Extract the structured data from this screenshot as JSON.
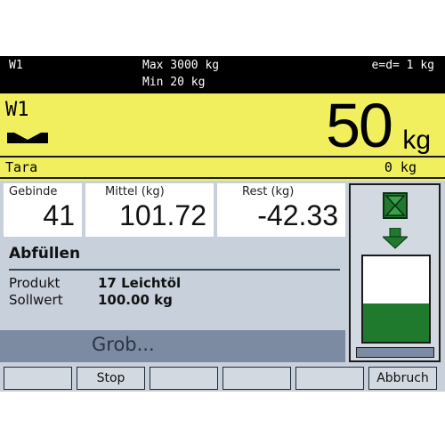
{
  "status_bar": {
    "scale_name": "W1",
    "max_capacity": "Max 3000 kg",
    "min_capacity": "Min 20 kg",
    "division": "e=d= 1 kg"
  },
  "weight_display": {
    "scale_label": "W1",
    "weight_value": "50",
    "weight_unit": "kg",
    "tara_label": "Tara",
    "tara_value": "0 kg"
  },
  "stats": [
    {
      "label": "Gebinde",
      "value": "41"
    },
    {
      "label": "Mittel (kg)",
      "value": "101.72"
    },
    {
      "label": "Rest (kg)",
      "value": "-42.33"
    }
  ],
  "filling": {
    "title": "Abfüllen",
    "product_label": "Produkt",
    "product_value": "17 Leichtöl",
    "setpoint_label": "Sollwert",
    "setpoint_value": "100.00 kg",
    "phase_text": "Grob..."
  },
  "tank": {
    "fill_fraction": 0.45,
    "fill_color": "#1f7a2e",
    "valve_color": "#1f7a2e",
    "arrow_color": "#1f7a2e"
  },
  "softkeys": [
    "",
    "Stop",
    "",
    "",
    "",
    "Abbruch"
  ]
}
